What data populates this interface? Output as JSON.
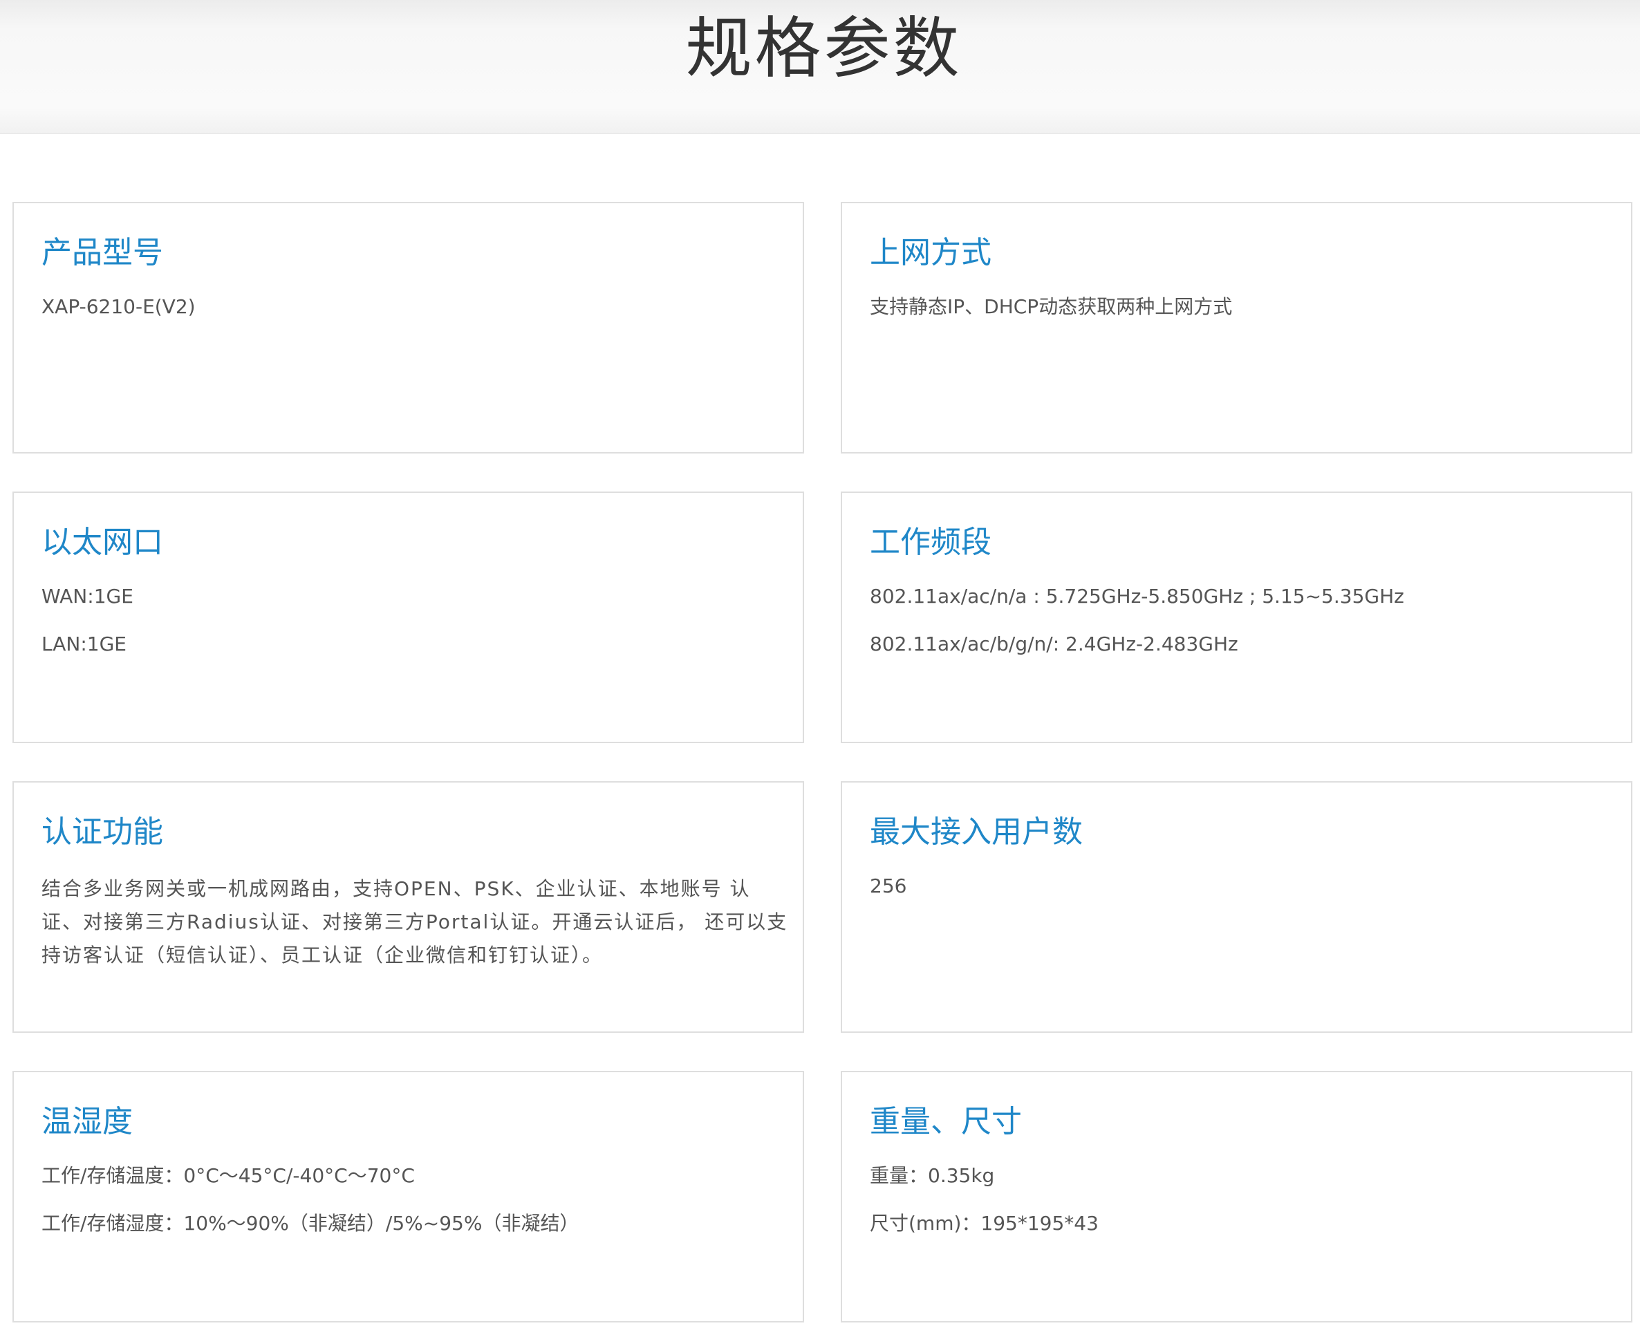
{
  "page": {
    "title": "规格参数"
  },
  "specs": [
    {
      "title": "产品型号",
      "lines": [
        "XAP-6210-E(V2)"
      ]
    },
    {
      "title": "上网方式",
      "lines": [
        "支持静态IP、DHCP动态获取两种上网方式"
      ]
    },
    {
      "title": "以太网口",
      "lines": [
        "WAN:1GE",
        "LAN:1GE"
      ]
    },
    {
      "title": "工作频段",
      "lines": [
        "802.11ax/ac/n/a : 5.725GHz-5.850GHz ; 5.15~5.35GHz",
        "802.11ax/ac/b/g/n/: 2.4GHz-2.483GHz"
      ]
    },
    {
      "title": "认证功能",
      "paragraph": "结合多业务网关或一机成网路由，支持OPEN、PSK、企业认证、本地账号 认证、对接第三方Radius认证、对接第三方Portal认证。开通云认证后， 还可以支持访客认证（短信认证）、员工认证（企业微信和钉钉认证）。"
    },
    {
      "title": "最大接入用户数",
      "lines": [
        "256"
      ]
    },
    {
      "title": "温湿度",
      "lines": [
        "工作/存储温度：0°C～45°C/-40°C～70°C",
        "工作/存储湿度：10%～90%（非凝结）/5%~95%（非凝结）"
      ]
    },
    {
      "title": "重量、尺寸",
      "lines": [
        "重量：0.35kg",
        "尺寸(mm)：195*195*43"
      ]
    }
  ],
  "colors": {
    "title_accent": "#1f87c8",
    "card_border": "#dedede",
    "body_text": "#555555"
  }
}
